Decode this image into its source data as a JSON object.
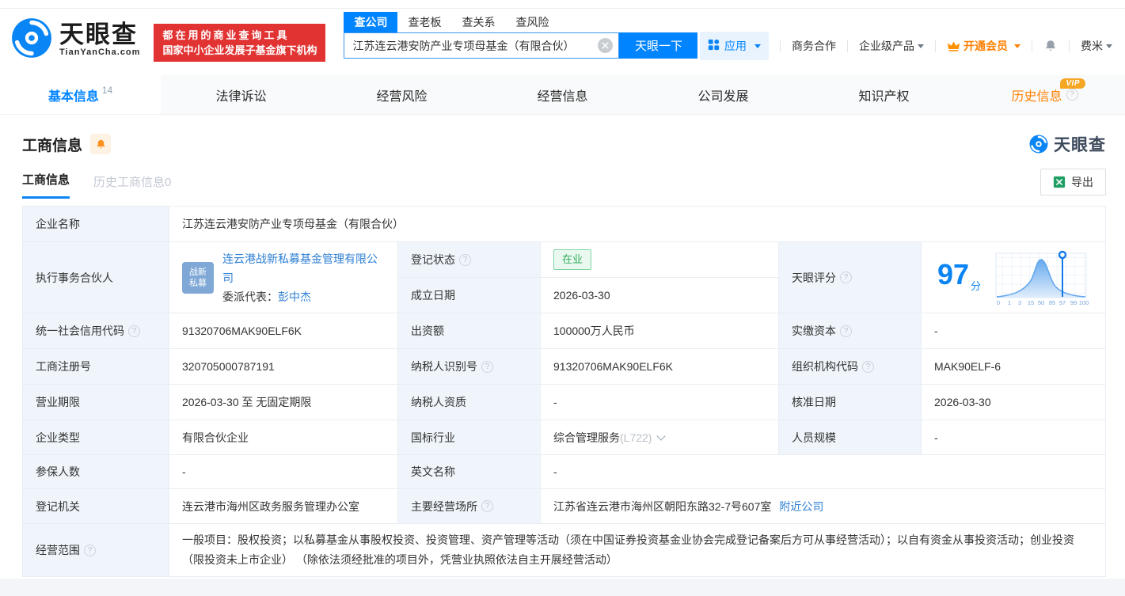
{
  "colors": {
    "brand_blue": "#0084ff",
    "link_blue": "#2e7fd4",
    "orange": "#ff8000",
    "banner_red": "#e23333",
    "status_green": "#2fae5e",
    "label_bg": "#eff5fb"
  },
  "icons": {
    "question": "?",
    "vip_badge": "VIP",
    "clear": "×",
    "caret_down": "▾",
    "chevron_down": "⌄",
    "bell": "bell-shape",
    "crown": "crown-shape",
    "excel": "x-sheet",
    "apps_grid": "grid-squares",
    "logo_swirl": "eye-swirl"
  },
  "header": {
    "logo_cn": "天眼查",
    "logo_en": "TianYanCha.com",
    "banner_line1": "都在用的商业查询工具",
    "banner_line2": "国家中小企业发展子基金旗下机构",
    "search_tabs": [
      "查公司",
      "查老板",
      "查关系",
      "查风险"
    ],
    "search_value": "江苏连云港安防产业专项母基金（有限合伙）",
    "search_button": "天眼一下",
    "menu_apps": "应用",
    "menu_cooperation": "商务合作",
    "menu_enterprise": "企业级产品",
    "menu_vip": "开通会员",
    "menu_user": "费米"
  },
  "nav": {
    "tabs": [
      {
        "label": "基本信息",
        "count": "14"
      },
      {
        "label": "法律诉讼"
      },
      {
        "label": "经营风险"
      },
      {
        "label": "经营信息"
      },
      {
        "label": "公司发展"
      },
      {
        "label": "知识产权"
      },
      {
        "label": "历史信息"
      }
    ]
  },
  "section": {
    "title": "工商信息",
    "watermark": "天眼查",
    "subtab_active": "工商信息",
    "subtab_history": "历史工商信息0",
    "export": "导出"
  },
  "table": {
    "company_name": {
      "label": "企业名称",
      "value": "江苏连云港安防产业专项母基金（有限合伙）"
    },
    "executive_partner": {
      "label": "执行事务合伙人",
      "avatar_line1": "战新",
      "avatar_line2": "私募",
      "company": "连云港战新私募基金管理有限公司",
      "rep_label": "委派代表：",
      "rep_name": "彭中杰"
    },
    "reg_status": {
      "label": "登记状态",
      "value": "在业"
    },
    "establish_date": {
      "label": "成立日期",
      "value": "2026-03-30"
    },
    "tyc_score": {
      "label": "天眼评分",
      "value": "97",
      "unit": "分",
      "ticks": [
        "0",
        "1",
        "3",
        "15",
        "50",
        "85",
        "97",
        "99",
        "100"
      ],
      "marker": "97"
    },
    "credit_code": {
      "label": "统一社会信用代码",
      "value": "91320706MAK90ELF6K"
    },
    "contribution": {
      "label": "出资额",
      "value": "100000万人民币"
    },
    "paid_capital": {
      "label": "实缴资本",
      "value": "-"
    },
    "reg_number": {
      "label": "工商注册号",
      "value": "320705000787191"
    },
    "taxpayer_id": {
      "label": "纳税人识别号",
      "value": "91320706MAK90ELF6K"
    },
    "org_code": {
      "label": "组织机构代码",
      "value": "MAK90ELF-6"
    },
    "business_term": {
      "label": "营业期限",
      "value": "2026-03-30 至 无固定期限"
    },
    "taxpayer_quality": {
      "label": "纳税人资质",
      "value": "-"
    },
    "approval_date": {
      "label": "核准日期",
      "value": "2026-03-30"
    },
    "company_type": {
      "label": "企业类型",
      "value": "有限合伙企业"
    },
    "industry": {
      "label": "国标行业",
      "value": "综合管理服务",
      "code": "(L722)"
    },
    "staff_size": {
      "label": "人员规模",
      "value": "-"
    },
    "insured_count": {
      "label": "参保人数",
      "value": "-"
    },
    "english_name": {
      "label": "英文名称",
      "value": "-"
    },
    "reg_authority": {
      "label": "登记机关",
      "value": "连云港市海州区政务服务管理办公室"
    },
    "business_address": {
      "label": "主要经营场所",
      "value": "江苏省连云港市海州区朝阳东路32-7号607室",
      "nearby": "附近公司"
    },
    "business_scope": {
      "label": "经营范围",
      "value": "一般项目：股权投资；以私募基金从事股权投资、投资管理、资产管理等活动（须在中国证券投资基金业协会完成登记备案后方可从事经营活动）；以自有资金从事投资活动；创业投资（限投资未上市企业） （除依法须经批准的项目外，凭营业执照依法自主开展经营活动）"
    }
  }
}
